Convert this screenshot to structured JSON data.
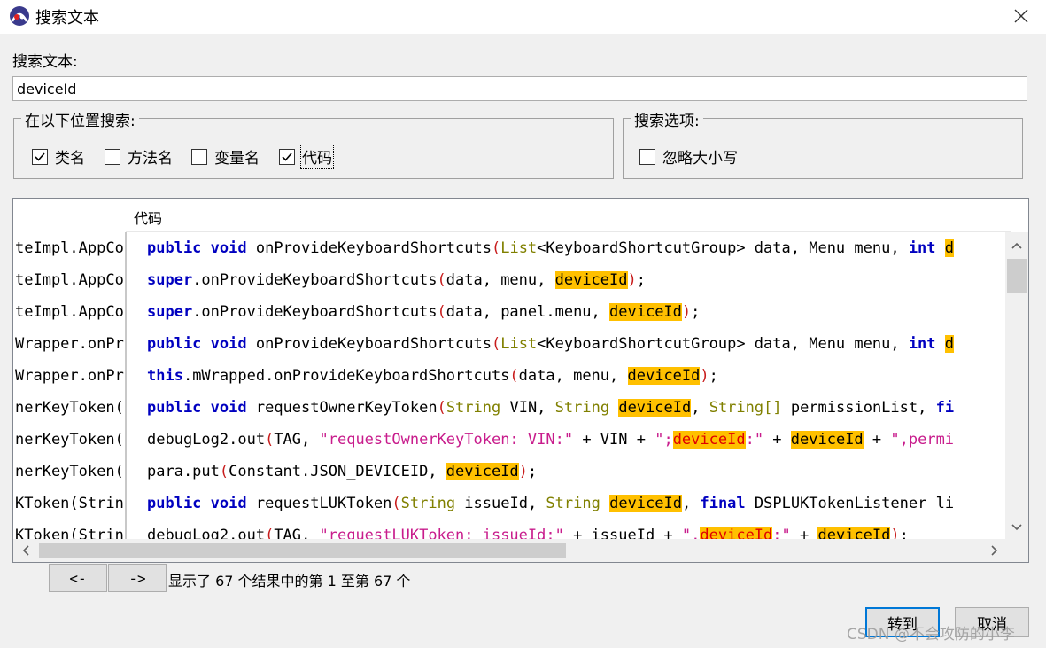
{
  "window": {
    "title": "搜索文本",
    "icon": "app-logo-icon",
    "close_icon": "close-icon"
  },
  "search": {
    "label": "搜索文本:",
    "value": "deviceId",
    "placeholder": ""
  },
  "location_group": {
    "legend": "在以下位置搜索:",
    "options": [
      {
        "label": "类名",
        "checked": true
      },
      {
        "label": "方法名",
        "checked": false
      },
      {
        "label": "变量名",
        "checked": false
      },
      {
        "label": "代码",
        "checked": true
      }
    ]
  },
  "options_group": {
    "legend": "搜索选项:",
    "options": [
      {
        "label": "忽略大小写",
        "checked": false
      }
    ]
  },
  "results": {
    "column_header": "代码",
    "left_col": [
      "teImpl.AppCo",
      "teImpl.AppCo",
      "teImpl.AppCo",
      "Wrapper.onPr",
      "Wrapper.onPr",
      "nerKeyToken(",
      "nerKeyToken(",
      "nerKeyToken(",
      "KToken(Strin",
      "KToken(Strin"
    ],
    "code_rows": [
      [
        {
          "t": "public",
          "c": "kw"
        },
        {
          "t": " "
        },
        {
          "t": "void",
          "c": "kw"
        },
        {
          "t": " onProvideKeyboardShortcuts"
        },
        {
          "t": "(",
          "c": "br"
        },
        {
          "t": "List",
          "c": "ty"
        },
        {
          "t": "<KeyboardShortcutGroup> data, Menu menu, "
        },
        {
          "t": "int",
          "c": "kw"
        },
        {
          "t": " "
        },
        {
          "t": "d",
          "c": "hl"
        }
      ],
      [
        {
          "t": "super",
          "c": "kw"
        },
        {
          "t": ".onProvideKeyboardShortcuts"
        },
        {
          "t": "(",
          "c": "br"
        },
        {
          "t": "data, menu, "
        },
        {
          "t": "deviceId",
          "c": "hl"
        },
        {
          "t": ")",
          "c": "br"
        },
        {
          "t": ";"
        }
      ],
      [
        {
          "t": "super",
          "c": "kw"
        },
        {
          "t": ".onProvideKeyboardShortcuts"
        },
        {
          "t": "(",
          "c": "br"
        },
        {
          "t": "data, panel.menu, "
        },
        {
          "t": "deviceId",
          "c": "hl"
        },
        {
          "t": ")",
          "c": "br"
        },
        {
          "t": ";"
        }
      ],
      [
        {
          "t": "public",
          "c": "kw"
        },
        {
          "t": " "
        },
        {
          "t": "void",
          "c": "kw"
        },
        {
          "t": " onProvideKeyboardShortcuts"
        },
        {
          "t": "(",
          "c": "br"
        },
        {
          "t": "List",
          "c": "ty"
        },
        {
          "t": "<KeyboardShortcutGroup> data, Menu menu, "
        },
        {
          "t": "int",
          "c": "kw"
        },
        {
          "t": " "
        },
        {
          "t": "d",
          "c": "hl"
        }
      ],
      [
        {
          "t": "this",
          "c": "kw"
        },
        {
          "t": ".mWrapped.onProvideKeyboardShortcuts"
        },
        {
          "t": "(",
          "c": "br"
        },
        {
          "t": "data, menu, "
        },
        {
          "t": "deviceId",
          "c": "hl"
        },
        {
          "t": ")",
          "c": "br"
        },
        {
          "t": ";"
        }
      ],
      [
        {
          "t": "public",
          "c": "kw"
        },
        {
          "t": " "
        },
        {
          "t": "void",
          "c": "kw"
        },
        {
          "t": " requestOwnerKeyToken"
        },
        {
          "t": "(",
          "c": "br"
        },
        {
          "t": "String",
          "c": "ty"
        },
        {
          "t": " VIN, "
        },
        {
          "t": "String",
          "c": "ty"
        },
        {
          "t": " "
        },
        {
          "t": "deviceId",
          "c": "hl"
        },
        {
          "t": ", "
        },
        {
          "t": "String[]",
          "c": "ty"
        },
        {
          "t": " permissionList, "
        },
        {
          "t": "fi",
          "c": "kw"
        }
      ],
      [
        {
          "t": "debugLog2.out"
        },
        {
          "t": "(",
          "c": "br"
        },
        {
          "t": "TAG, "
        },
        {
          "t": "\"requestOwnerKeyToken: VIN:\"",
          "c": "st"
        },
        {
          "t": " + VIN + "
        },
        {
          "t": "\";",
          "c": "st"
        },
        {
          "t": "deviceId",
          "c": "hl-red"
        },
        {
          "t": ":\"",
          "c": "st"
        },
        {
          "t": " + "
        },
        {
          "t": "deviceId",
          "c": "hl"
        },
        {
          "t": " + "
        },
        {
          "t": "\",permi",
          "c": "st"
        }
      ],
      [
        {
          "t": "para.put"
        },
        {
          "t": "(",
          "c": "br"
        },
        {
          "t": "Constant.JSON_DEVICEID, "
        },
        {
          "t": "deviceId",
          "c": "hl"
        },
        {
          "t": ")",
          "c": "br"
        },
        {
          "t": ";"
        }
      ],
      [
        {
          "t": "public",
          "c": "kw"
        },
        {
          "t": " "
        },
        {
          "t": "void",
          "c": "kw"
        },
        {
          "t": " requestLUKToken"
        },
        {
          "t": "(",
          "c": "br"
        },
        {
          "t": "String",
          "c": "ty"
        },
        {
          "t": " issueId, "
        },
        {
          "t": "String",
          "c": "ty"
        },
        {
          "t": " "
        },
        {
          "t": "deviceId",
          "c": "hl"
        },
        {
          "t": ", "
        },
        {
          "t": "final",
          "c": "kw"
        },
        {
          "t": " DSPLUKTokenListener li"
        }
      ],
      [
        {
          "t": "debugLog2.out"
        },
        {
          "t": "(",
          "c": "br"
        },
        {
          "t": "TAG, "
        },
        {
          "t": "\"requestLUKToken: issueId:\"",
          "c": "st"
        },
        {
          "t": " + issueId + "
        },
        {
          "t": "\",",
          "c": "st"
        },
        {
          "t": "deviceId",
          "c": "hl-red"
        },
        {
          "t": ":\"",
          "c": "st"
        },
        {
          "t": " + "
        },
        {
          "t": "deviceId",
          "c": "hl"
        },
        {
          "t": ")",
          "c": "br"
        },
        {
          "t": ";"
        }
      ]
    ],
    "scroll_icons": [
      "scroll-up-icon",
      "scroll-down-icon",
      "scroll-left-icon",
      "scroll-right-icon"
    ]
  },
  "pager": {
    "prev_label": "<-",
    "next_label": "->",
    "status": "显示了 67 个结果中的第 1 至第 67 个"
  },
  "buttons": {
    "goto": "转到",
    "cancel": "取消"
  },
  "watermark": "CSDN @不会攻防的小李",
  "colors": {
    "highlight": "#ffc000",
    "keyword": "#0000c0",
    "type": "#808000",
    "string": "#c81c8c",
    "bracket": "#c81c1c"
  }
}
